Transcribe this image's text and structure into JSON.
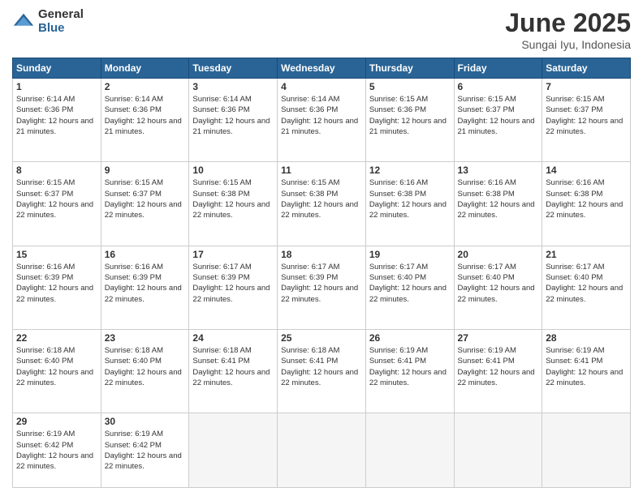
{
  "header": {
    "logo_general": "General",
    "logo_blue": "Blue",
    "title": "June 2025",
    "location": "Sungai Iyu, Indonesia"
  },
  "weekdays": [
    "Sunday",
    "Monday",
    "Tuesday",
    "Wednesday",
    "Thursday",
    "Friday",
    "Saturday"
  ],
  "weeks": [
    [
      {
        "day": "1",
        "sunrise": "6:14 AM",
        "sunset": "6:36 PM",
        "daylight": "12 hours and 21 minutes."
      },
      {
        "day": "2",
        "sunrise": "6:14 AM",
        "sunset": "6:36 PM",
        "daylight": "12 hours and 21 minutes."
      },
      {
        "day": "3",
        "sunrise": "6:14 AM",
        "sunset": "6:36 PM",
        "daylight": "12 hours and 21 minutes."
      },
      {
        "day": "4",
        "sunrise": "6:14 AM",
        "sunset": "6:36 PM",
        "daylight": "12 hours and 21 minutes."
      },
      {
        "day": "5",
        "sunrise": "6:15 AM",
        "sunset": "6:36 PM",
        "daylight": "12 hours and 21 minutes."
      },
      {
        "day": "6",
        "sunrise": "6:15 AM",
        "sunset": "6:37 PM",
        "daylight": "12 hours and 21 minutes."
      },
      {
        "day": "7",
        "sunrise": "6:15 AM",
        "sunset": "6:37 PM",
        "daylight": "12 hours and 22 minutes."
      }
    ],
    [
      {
        "day": "8",
        "sunrise": "6:15 AM",
        "sunset": "6:37 PM",
        "daylight": "12 hours and 22 minutes."
      },
      {
        "day": "9",
        "sunrise": "6:15 AM",
        "sunset": "6:37 PM",
        "daylight": "12 hours and 22 minutes."
      },
      {
        "day": "10",
        "sunrise": "6:15 AM",
        "sunset": "6:38 PM",
        "daylight": "12 hours and 22 minutes."
      },
      {
        "day": "11",
        "sunrise": "6:15 AM",
        "sunset": "6:38 PM",
        "daylight": "12 hours and 22 minutes."
      },
      {
        "day": "12",
        "sunrise": "6:16 AM",
        "sunset": "6:38 PM",
        "daylight": "12 hours and 22 minutes."
      },
      {
        "day": "13",
        "sunrise": "6:16 AM",
        "sunset": "6:38 PM",
        "daylight": "12 hours and 22 minutes."
      },
      {
        "day": "14",
        "sunrise": "6:16 AM",
        "sunset": "6:38 PM",
        "daylight": "12 hours and 22 minutes."
      }
    ],
    [
      {
        "day": "15",
        "sunrise": "6:16 AM",
        "sunset": "6:39 PM",
        "daylight": "12 hours and 22 minutes."
      },
      {
        "day": "16",
        "sunrise": "6:16 AM",
        "sunset": "6:39 PM",
        "daylight": "12 hours and 22 minutes."
      },
      {
        "day": "17",
        "sunrise": "6:17 AM",
        "sunset": "6:39 PM",
        "daylight": "12 hours and 22 minutes."
      },
      {
        "day": "18",
        "sunrise": "6:17 AM",
        "sunset": "6:39 PM",
        "daylight": "12 hours and 22 minutes."
      },
      {
        "day": "19",
        "sunrise": "6:17 AM",
        "sunset": "6:40 PM",
        "daylight": "12 hours and 22 minutes."
      },
      {
        "day": "20",
        "sunrise": "6:17 AM",
        "sunset": "6:40 PM",
        "daylight": "12 hours and 22 minutes."
      },
      {
        "day": "21",
        "sunrise": "6:17 AM",
        "sunset": "6:40 PM",
        "daylight": "12 hours and 22 minutes."
      }
    ],
    [
      {
        "day": "22",
        "sunrise": "6:18 AM",
        "sunset": "6:40 PM",
        "daylight": "12 hours and 22 minutes."
      },
      {
        "day": "23",
        "sunrise": "6:18 AM",
        "sunset": "6:40 PM",
        "daylight": "12 hours and 22 minutes."
      },
      {
        "day": "24",
        "sunrise": "6:18 AM",
        "sunset": "6:41 PM",
        "daylight": "12 hours and 22 minutes."
      },
      {
        "day": "25",
        "sunrise": "6:18 AM",
        "sunset": "6:41 PM",
        "daylight": "12 hours and 22 minutes."
      },
      {
        "day": "26",
        "sunrise": "6:19 AM",
        "sunset": "6:41 PM",
        "daylight": "12 hours and 22 minutes."
      },
      {
        "day": "27",
        "sunrise": "6:19 AM",
        "sunset": "6:41 PM",
        "daylight": "12 hours and 22 minutes."
      },
      {
        "day": "28",
        "sunrise": "6:19 AM",
        "sunset": "6:41 PM",
        "daylight": "12 hours and 22 minutes."
      }
    ],
    [
      {
        "day": "29",
        "sunrise": "6:19 AM",
        "sunset": "6:42 PM",
        "daylight": "12 hours and 22 minutes."
      },
      {
        "day": "30",
        "sunrise": "6:19 AM",
        "sunset": "6:42 PM",
        "daylight": "12 hours and 22 minutes."
      },
      {
        "day": "",
        "sunrise": "",
        "sunset": "",
        "daylight": ""
      },
      {
        "day": "",
        "sunrise": "",
        "sunset": "",
        "daylight": ""
      },
      {
        "day": "",
        "sunrise": "",
        "sunset": "",
        "daylight": ""
      },
      {
        "day": "",
        "sunrise": "",
        "sunset": "",
        "daylight": ""
      },
      {
        "day": "",
        "sunrise": "",
        "sunset": "",
        "daylight": ""
      }
    ]
  ]
}
